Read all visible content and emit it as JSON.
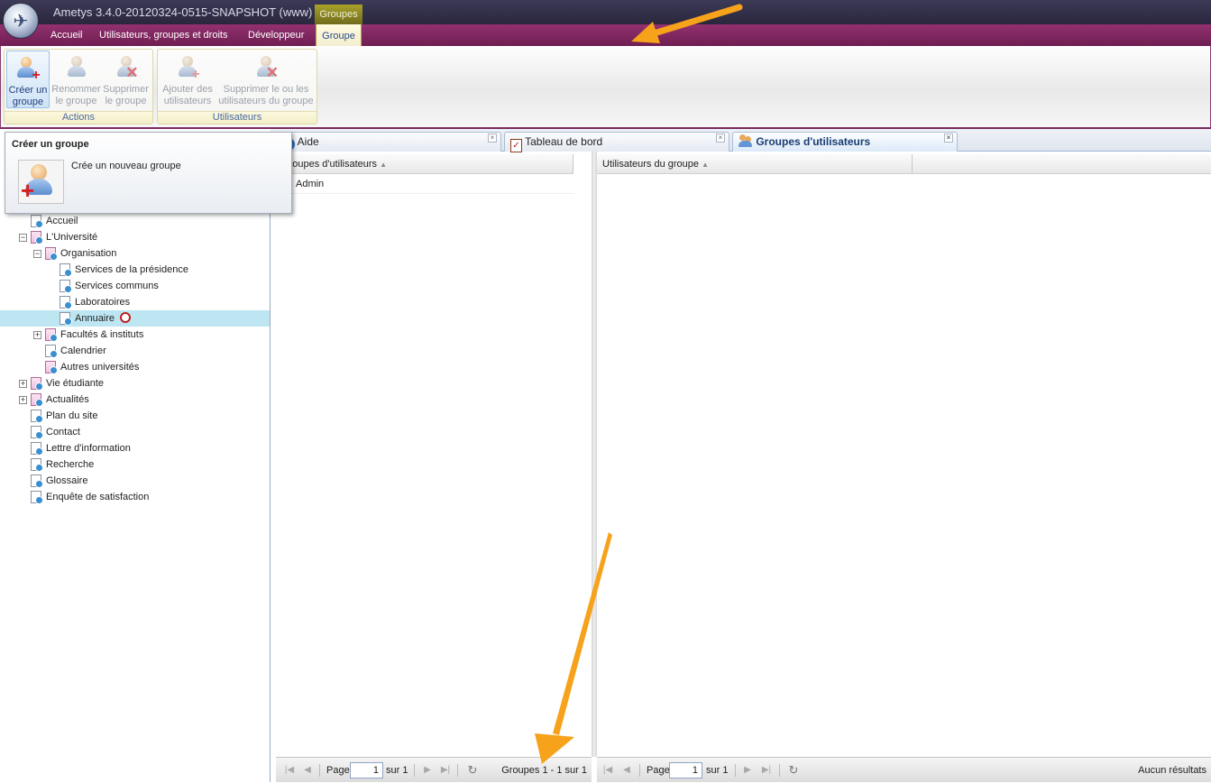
{
  "app": {
    "title": "Ametys 3.4.0-20120324-0515-SNAPSHOT (www)",
    "contextual_tab_group": "Groupes"
  },
  "ribbon_tabs": [
    "Accueil",
    "Utilisateurs, groupes et droits",
    "Développeur",
    "Groupe"
  ],
  "ribbon": {
    "actions": {
      "label": "Actions",
      "buttons": [
        {
          "line1": "Créer un",
          "line2": "groupe",
          "enabled": true
        },
        {
          "line1": "Renommer",
          "line2": "le groupe",
          "enabled": false
        },
        {
          "line1": "Supprimer",
          "line2": "le groupe",
          "enabled": false
        }
      ]
    },
    "users": {
      "label": "Utilisateurs",
      "buttons": [
        {
          "line1": "Ajouter des",
          "line2": "utilisateurs",
          "enabled": false
        },
        {
          "line1": "Supprimer le ou les",
          "line2": "utilisateurs du groupe",
          "enabled": false
        }
      ]
    }
  },
  "tooltip": {
    "title": "Créer un groupe",
    "description": "Crée un nouveau groupe"
  },
  "doc_tabs": [
    {
      "label": "Aide",
      "selected": false
    },
    {
      "label": "Tableau de bord",
      "selected": false
    },
    {
      "label": "Groupes d'utilisateurs",
      "selected": true
    }
  ],
  "sitemap": [
    {
      "label": "Accueil",
      "level": 0,
      "pink": false,
      "expander": ""
    },
    {
      "label": "L'Université",
      "level": 0,
      "pink": true,
      "expander": "−"
    },
    {
      "label": "Organisation",
      "level": 1,
      "pink": true,
      "expander": "−"
    },
    {
      "label": "Services de la présidence",
      "level": 2,
      "pink": false,
      "expander": ""
    },
    {
      "label": "Services communs",
      "level": 2,
      "pink": false,
      "expander": ""
    },
    {
      "label": "Laboratoires",
      "level": 2,
      "pink": false,
      "expander": ""
    },
    {
      "label": "Annuaire",
      "level": 2,
      "pink": false,
      "expander": "",
      "selected": true
    },
    {
      "label": "Facultés & instituts",
      "level": 1,
      "pink": true,
      "expander": "+"
    },
    {
      "label": "Calendrier",
      "level": 1,
      "pink": false,
      "expander": ""
    },
    {
      "label": "Autres universités",
      "level": 1,
      "pink": true,
      "expander": ""
    },
    {
      "label": "Vie étudiante",
      "level": 0,
      "pink": true,
      "expander": "+"
    },
    {
      "label": "Actualités",
      "level": 0,
      "pink": true,
      "expander": "+"
    },
    {
      "label": "Plan du site",
      "level": 0,
      "pink": false,
      "expander": ""
    },
    {
      "label": "Contact",
      "level": 0,
      "pink": false,
      "expander": ""
    },
    {
      "label": "Lettre d'information",
      "level": 0,
      "pink": false,
      "expander": ""
    },
    {
      "label": "Recherche",
      "level": 0,
      "pink": false,
      "expander": ""
    },
    {
      "label": "Glossaire",
      "level": 0,
      "pink": false,
      "expander": ""
    },
    {
      "label": "Enquête de satisfaction",
      "level": 0,
      "pink": false,
      "expander": ""
    }
  ],
  "groups_grid": {
    "header": "Groupes d'utilisateurs",
    "rows": [
      "Admin"
    ],
    "pager": {
      "page_label": "Page",
      "page": "1",
      "of_label": "sur 1",
      "status": "Groupes 1 - 1 sur 1"
    }
  },
  "members_grid": {
    "header": "Utilisateurs du groupe",
    "rows": [],
    "pager": {
      "page_label": "Page",
      "page": "1",
      "of_label": "sur 1",
      "status": "Aucun résultats"
    }
  },
  "colors": {
    "ribbon_tab_bar": "#7d2560",
    "accent_arrow": "#f7a21b",
    "selected_row": "#bde6f2"
  }
}
